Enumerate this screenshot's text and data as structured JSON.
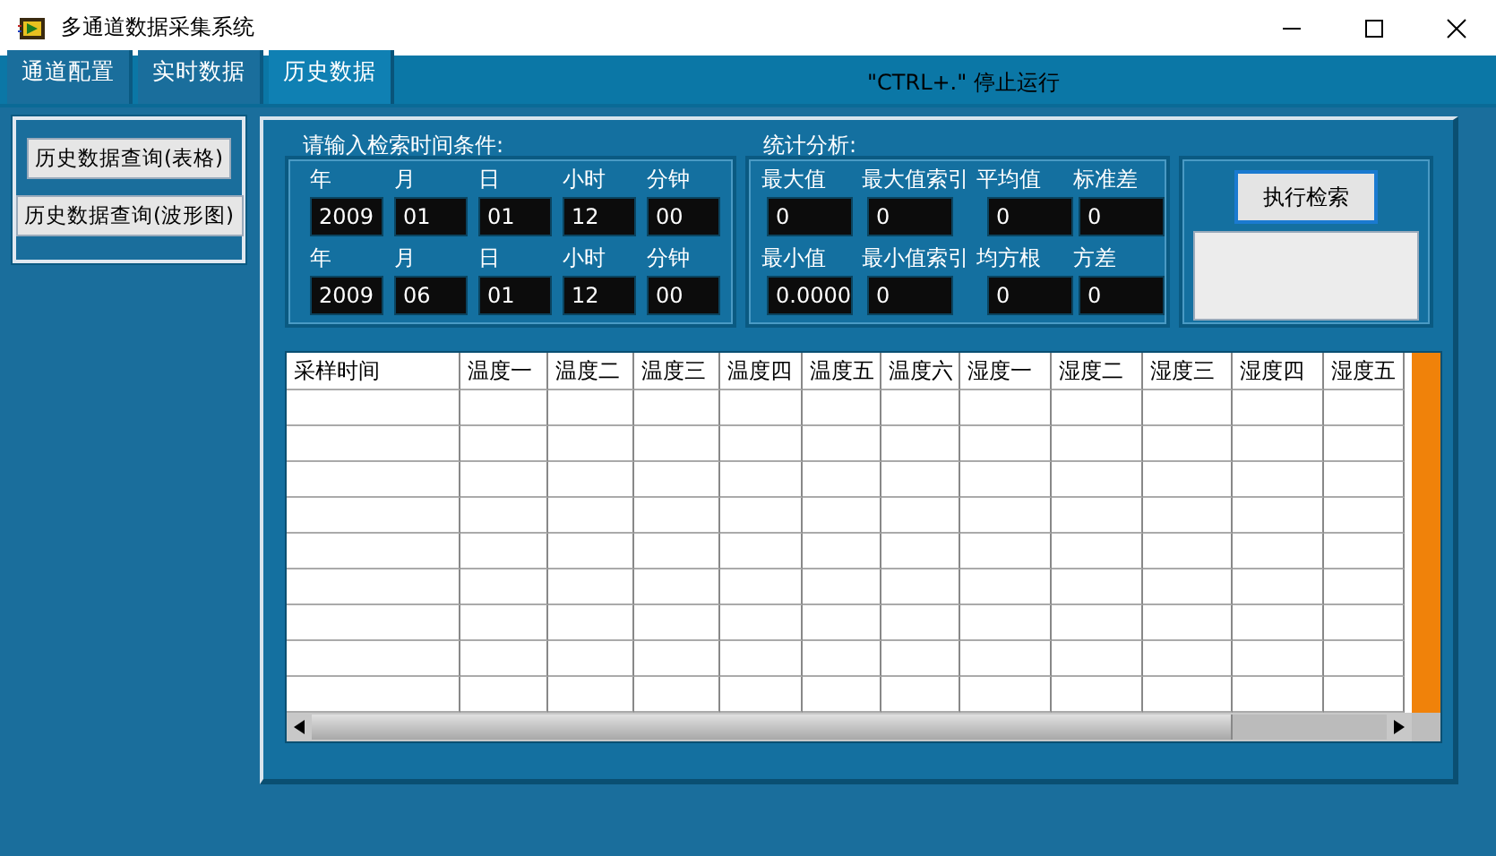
{
  "window": {
    "title": "多通道数据采集系统"
  },
  "tabs": [
    {
      "label": "通道配置",
      "selected": false
    },
    {
      "label": "实时数据",
      "selected": false
    },
    {
      "label": "历史数据",
      "selected": true
    }
  ],
  "hint": "\"CTRL+.\" 停止运行",
  "query_buttons": [
    "历史数据查询(表格)",
    "历史数据查询(波形图)"
  ],
  "time_condition": {
    "title": "请输入检索时间条件:",
    "rows": [
      [
        {
          "label": "年",
          "value": "2009"
        },
        {
          "label": "月",
          "value": "01"
        },
        {
          "label": "日",
          "value": "01"
        },
        {
          "label": "小时",
          "value": "12"
        },
        {
          "label": "分钟",
          "value": "00"
        }
      ],
      [
        {
          "label": "年",
          "value": "2009"
        },
        {
          "label": "月",
          "value": "06"
        },
        {
          "label": "日",
          "value": "01"
        },
        {
          "label": "小时",
          "value": "12"
        },
        {
          "label": "分钟",
          "value": "00"
        }
      ]
    ]
  },
  "statistics": {
    "title": "统计分析:",
    "rows": [
      [
        {
          "label": "最大值",
          "value": "0"
        },
        {
          "label": "最大值索引",
          "value": "0"
        },
        {
          "label": "平均值",
          "value": "0"
        },
        {
          "label": "标准差",
          "value": "0"
        }
      ],
      [
        {
          "label": "最小值",
          "value": "0.0000"
        },
        {
          "label": "最小值索引",
          "value": "0"
        },
        {
          "label": "均方根",
          "value": "0"
        },
        {
          "label": "方差",
          "value": "0"
        }
      ]
    ]
  },
  "search_button": "执行检索",
  "table": {
    "columns": [
      "采样时间",
      "温度一",
      "温度二",
      "温度三",
      "温度四",
      "温度五",
      "温度六",
      "湿度一",
      "湿度二",
      "湿度三",
      "湿度四",
      "湿度五"
    ]
  }
}
